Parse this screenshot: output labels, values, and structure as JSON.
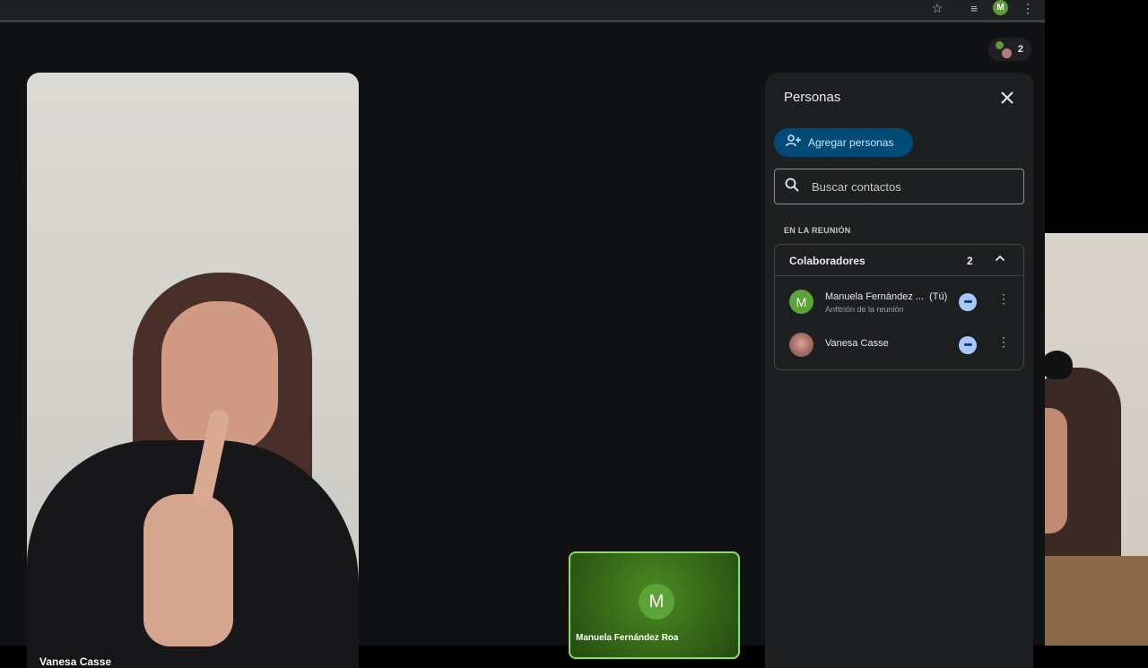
{
  "browser": {
    "profile_initial": "M"
  },
  "meeting": {
    "participant_count": "2",
    "main_tile_name": "Vanesa Casse",
    "self_tile_name": "Manuela Fernández Roa",
    "self_initial": "M"
  },
  "people_panel": {
    "title": "Personas",
    "add_people_label": "Agregar personas",
    "search_placeholder": "Buscar contactos",
    "section_heading": "EN LA REUNIÓN",
    "group_label": "Colaboradores",
    "group_count": "2",
    "participants": [
      {
        "initial": "M",
        "name": "Manuela Fernández ...",
        "you_label": "(Tú)",
        "role": "Anfitrión de la reunión"
      },
      {
        "initial": "",
        "name": "Vanesa Casse",
        "you_label": "",
        "role": ""
      }
    ]
  },
  "colors": {
    "accent_green": "#5ea339",
    "add_button_bg": "#004a77",
    "more_button_bg": "#a8c7fa",
    "panel_bg": "#1e1f20",
    "stage_bg": "#111213"
  }
}
